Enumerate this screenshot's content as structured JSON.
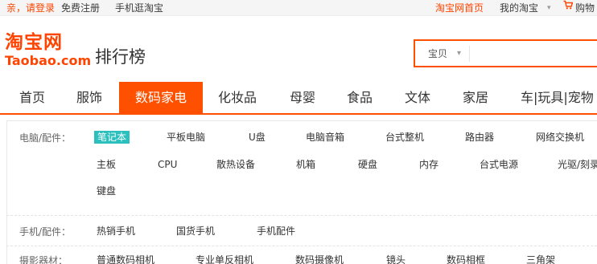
{
  "topbar": {
    "login": "亲，请登录",
    "register": "免费注册",
    "mobile": "手机逛淘宝",
    "home": "淘宝网首页",
    "my_taobao": "我的淘宝",
    "caret": "▾",
    "cart": "购物"
  },
  "header": {
    "logo_cn": "淘宝网",
    "logo_en": "Taobao.com",
    "page_title": "排行榜",
    "search": {
      "scope": "宝贝",
      "chevron": "▾",
      "value": "",
      "placeholder": ""
    }
  },
  "nav": {
    "tabs": [
      {
        "label": "首页"
      },
      {
        "label": "服饰"
      },
      {
        "label": "数码家电",
        "active": true
      },
      {
        "label": "化妆品"
      },
      {
        "label": "母婴"
      },
      {
        "label": "食品"
      },
      {
        "label": "文体"
      },
      {
        "label": "家居"
      },
      {
        "label": "车|玩具|宠物"
      }
    ]
  },
  "categories": [
    {
      "label": "电脑/配件：",
      "items": [
        "笔记本",
        "平板电脑",
        "U盘",
        "电脑音箱",
        "台式整机",
        "路由器",
        "网络交换机",
        "主板",
        "CPU",
        "散热设备",
        "机箱",
        "硬盘",
        "内存",
        "台式电源",
        "光驱/刻录",
        "键盘"
      ],
      "selected": "笔记本"
    },
    {
      "label": "手机/配件：",
      "items": [
        "热销手机",
        "国货手机",
        "手机配件"
      ]
    },
    {
      "label": "摄影器材：",
      "items": [
        "普通数码相机",
        "专业单反相机",
        "数码摄像机",
        "镜头",
        "数码相框",
        "三角架"
      ]
    }
  ],
  "colors": {
    "brand": "#ff5000",
    "link_accent": "#ff4400",
    "selected_tag": "#2bbfbd"
  },
  "icons": {
    "cart": "cart-icon",
    "logo": "taobao-logo"
  }
}
